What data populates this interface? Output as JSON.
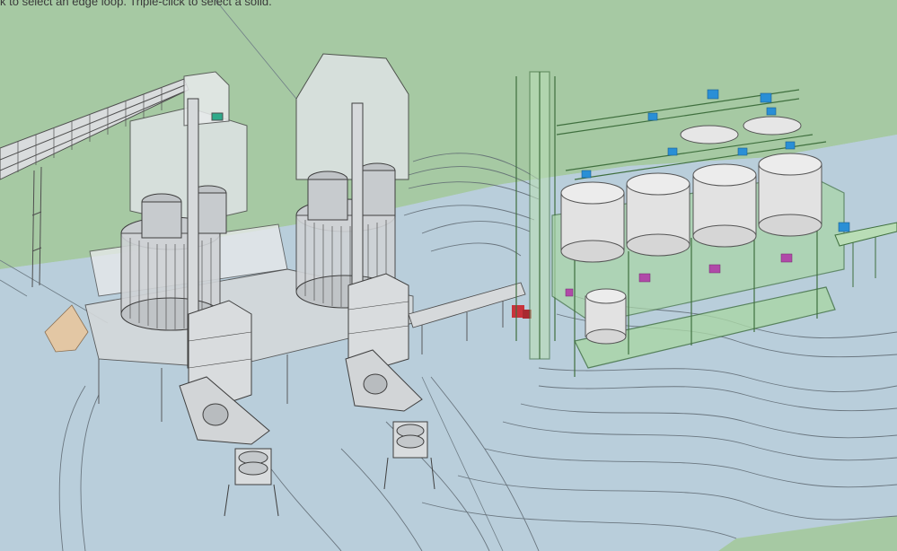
{
  "app": {
    "viewport_hint": "k to select an edge loop. Triple-click to select a solid."
  },
  "colors": {
    "sky": "#a6c9a3",
    "ground": "#b9cedb",
    "ground_light": "#c9dae3",
    "model_edge": "#4f4f4f",
    "mill_fill": "#d2d4d6",
    "mill_transparent": "#e3e6e8",
    "green_frame": "#8ec78c",
    "green_frame_edge": "#3f6f3e",
    "silo": "#e2e2e2",
    "accent_blue": "#2a8fd6",
    "accent_red": "#c8323b",
    "accent_magenta": "#b04aa8",
    "pile": "#e3c7a4",
    "contour": "#5d6770"
  },
  "scene": {
    "objects": [
      {
        "name": "conveyor-belt-left"
      },
      {
        "name": "vertical-mill-1"
      },
      {
        "name": "vertical-mill-2"
      },
      {
        "name": "baghouse-1"
      },
      {
        "name": "baghouse-2"
      },
      {
        "name": "fan-unit-1"
      },
      {
        "name": "fan-unit-2"
      },
      {
        "name": "silo-structure"
      },
      {
        "name": "bucket-elevator"
      },
      {
        "name": "stockpile"
      }
    ]
  }
}
